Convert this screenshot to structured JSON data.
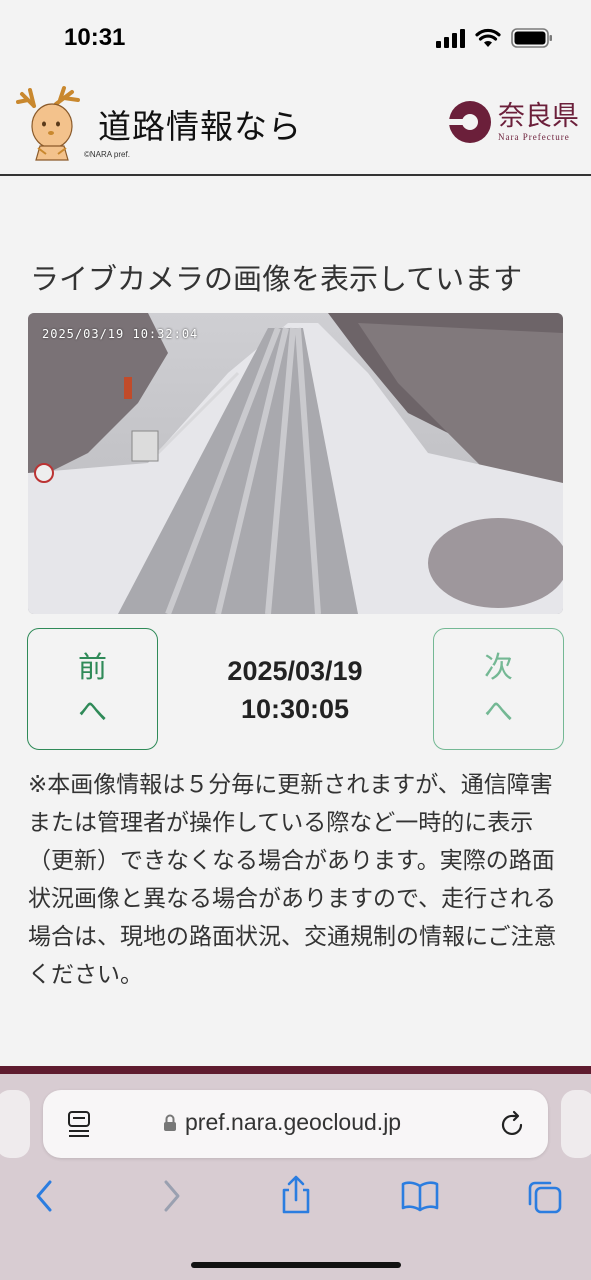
{
  "status_bar": {
    "time": "10:31"
  },
  "header": {
    "site_title": "道路情報なら",
    "copyright": "©NARA pref.",
    "pref_name": "奈良県",
    "pref_sub": "Nara Prefecture"
  },
  "main": {
    "heading": "ライブカメラの画像を表示しています",
    "camera_timestamp": "2025/03/19 10:32:04",
    "prev_button": {
      "line1": "前",
      "line2": "へ"
    },
    "next_button": {
      "line1": "次",
      "line2": "へ"
    },
    "date": "2025/03/19",
    "time": "10:30:05",
    "notice": "※本画像情報は５分毎に更新されますが、通信障害または管理者が操作している際など一時的に表示（更新）できなくなる場合があります。実際の路面状況画像と異なる場合がありますので、走行される場合は、現地の路面状況、交通規制の情報にご注意ください。"
  },
  "browser": {
    "url": "pref.nara.geocloud.jp"
  },
  "colors": {
    "accent_green": "#2f8a58",
    "pref_maroon": "#6b1f3a"
  },
  "icons": [
    "signal-icon",
    "wifi-icon",
    "battery-icon",
    "reader-icon",
    "lock-icon",
    "reload-icon",
    "back-icon",
    "forward-icon",
    "share-icon",
    "bookmarks-icon",
    "tabs-icon"
  ]
}
